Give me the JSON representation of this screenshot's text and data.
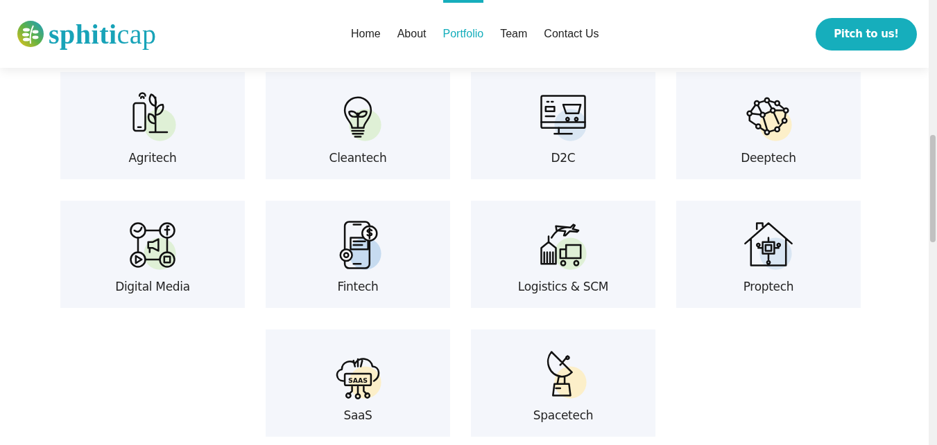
{
  "header": {
    "logo": "**sphiti**cap",
    "nav": [
      {
        "label": "Home",
        "selected": false
      },
      {
        "label": "About",
        "selected": false
      },
      {
        "label": "Portfolio",
        "selected": true
      },
      {
        "label": "Team",
        "selected": false
      },
      {
        "label": "Contact Us",
        "selected": false
      }
    ],
    "cta": "Pitch to us!"
  },
  "sectors": [
    {
      "label": "Agritech",
      "kind": "plant",
      "color": "#dff0d6"
    },
    {
      "label": "Cleantech",
      "kind": "bulb",
      "color": "#dff0d6"
    },
    {
      "label": "D2C",
      "kind": "monitor",
      "color": "#d9e6f3"
    },
    {
      "label": "Deeptech",
      "kind": "network",
      "color": "#fcefc9"
    },
    {
      "label": "Digital Media",
      "kind": "social",
      "color": "#dff0d6"
    },
    {
      "label": "Fintech",
      "kind": "phone",
      "color": "#c6dbf0"
    },
    {
      "label": "Logistics & SCM",
      "kind": "logistics",
      "color": "#dff0d6"
    },
    {
      "label": "Proptech",
      "kind": "house",
      "color": "#d9e6f3"
    },
    {
      "label": "SaaS",
      "kind": "cloud",
      "color": "#fcefc9",
      "icon_text": "SAAS"
    },
    {
      "label": "Spacetech",
      "kind": "dish",
      "color": "#fcefc9"
    }
  ]
}
